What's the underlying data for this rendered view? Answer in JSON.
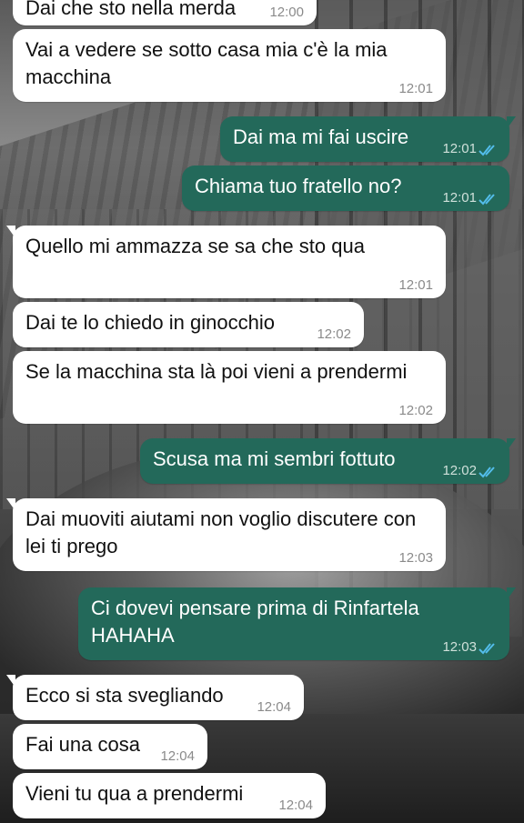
{
  "chat": {
    "messages": [
      {
        "dir": "in",
        "text": "Dai che sto nella merda",
        "time": "12:00"
      },
      {
        "dir": "in",
        "text": "Vai a vedere se sotto casa mia c'è la mia macchina",
        "time": "12:01"
      },
      {
        "dir": "out",
        "text": "Dai ma mi fai uscire",
        "time": "12:01",
        "status": "read"
      },
      {
        "dir": "out",
        "text": "Chiama tuo fratello no?",
        "time": "12:01",
        "status": "read"
      },
      {
        "dir": "in",
        "text": "Quello mi ammazza se sa che sto qua",
        "time": "12:01"
      },
      {
        "dir": "in",
        "text": "Dai te lo chiedo in ginocchio",
        "time": "12:02"
      },
      {
        "dir": "in",
        "text": "Se la macchina sta là poi vieni a prendermi",
        "time": "12:02"
      },
      {
        "dir": "out",
        "text": "Scusa ma mi sembri fottuto",
        "time": "12:02",
        "status": "read"
      },
      {
        "dir": "in",
        "text": "Dai muoviti aiutami non voglio discutere con lei ti prego",
        "time": "12:03"
      },
      {
        "dir": "out",
        "text": "Ci dovevi pensare prima di Rinfartela HAHAHA",
        "time": "12:03",
        "status": "read"
      },
      {
        "dir": "in",
        "text": "Ecco si sta svegliando",
        "time": "12:04"
      },
      {
        "dir": "in",
        "text": "Fai una cosa",
        "time": "12:04"
      },
      {
        "dir": "in",
        "text": "Vieni tu qua a prendermi",
        "time": "12:04"
      }
    ]
  },
  "colors": {
    "incoming_bubble": "#ffffff",
    "outgoing_bubble": "#23695a",
    "read_tick": "#53bdeb"
  },
  "icons": {
    "read_receipt": "double-check-icon"
  }
}
